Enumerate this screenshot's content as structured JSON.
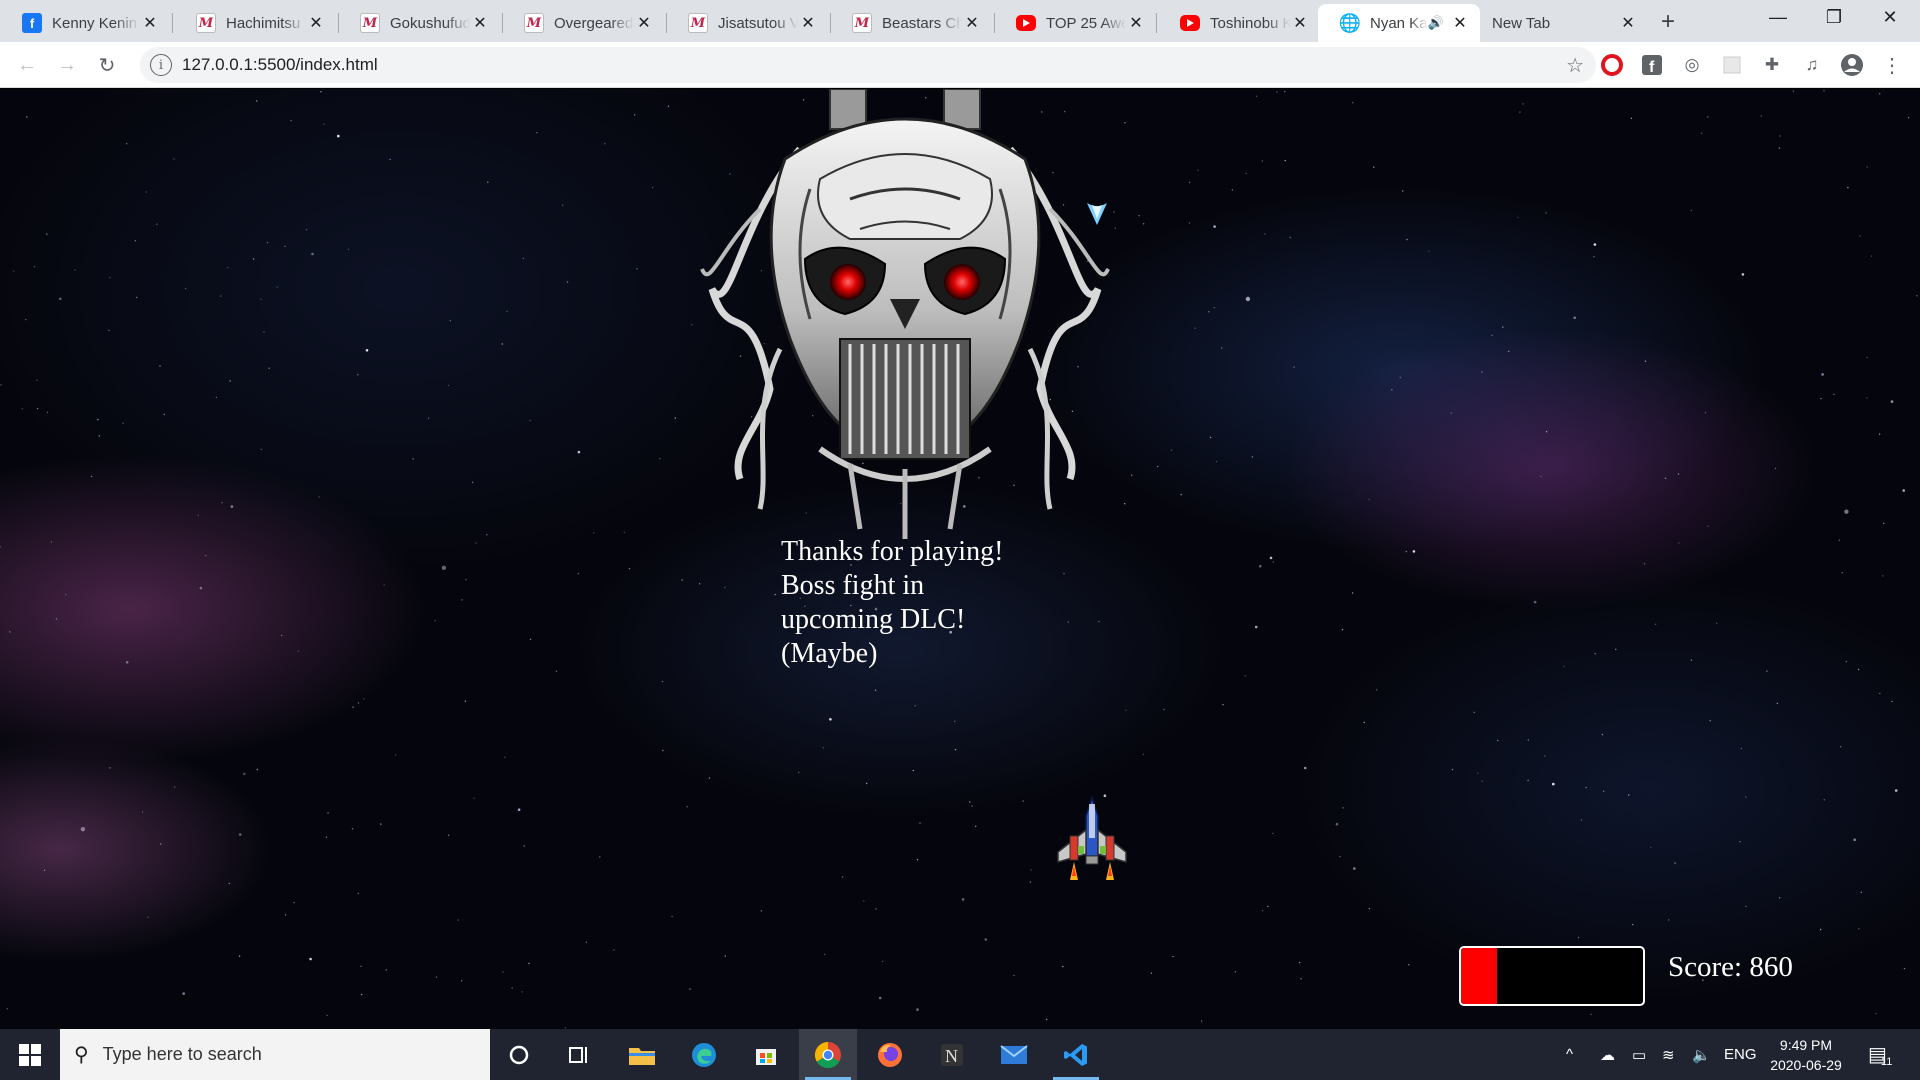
{
  "browser": {
    "tabs": [
      {
        "title": "Kenny Kenin",
        "favicon": "facebook-icon"
      },
      {
        "title": "Hachimitsu T",
        "favicon": "manga-icon"
      },
      {
        "title": "Gokushufudo",
        "favicon": "manga-icon"
      },
      {
        "title": "Overgeared",
        "favicon": "manga-icon"
      },
      {
        "title": "Jisatsutou V",
        "favicon": "manga-icon"
      },
      {
        "title": "Beastars Cha",
        "favicon": "manga-icon"
      },
      {
        "title": "TOP 25 Awe",
        "favicon": "youtube-icon"
      },
      {
        "title": "Toshinobu K",
        "favicon": "youtube-icon"
      },
      {
        "title": "Nyan Ka",
        "favicon": "globe-icon",
        "active": true,
        "audio": true
      },
      {
        "title": "New Tab",
        "favicon": ""
      }
    ],
    "url": "127.0.0.1:5500/index.html"
  },
  "game": {
    "end_message": "Thanks for playing!\nBoss fight in\nupcoming DLC!\n(Maybe)",
    "health_fraction": 0.2,
    "health_color": "#ff0000",
    "score_text": "Score: 860"
  },
  "taskbar": {
    "search_placeholder": "Type here to search",
    "language": "ENG",
    "time": "9:49 PM",
    "date": "2020-06-29",
    "notification_count": "11"
  }
}
